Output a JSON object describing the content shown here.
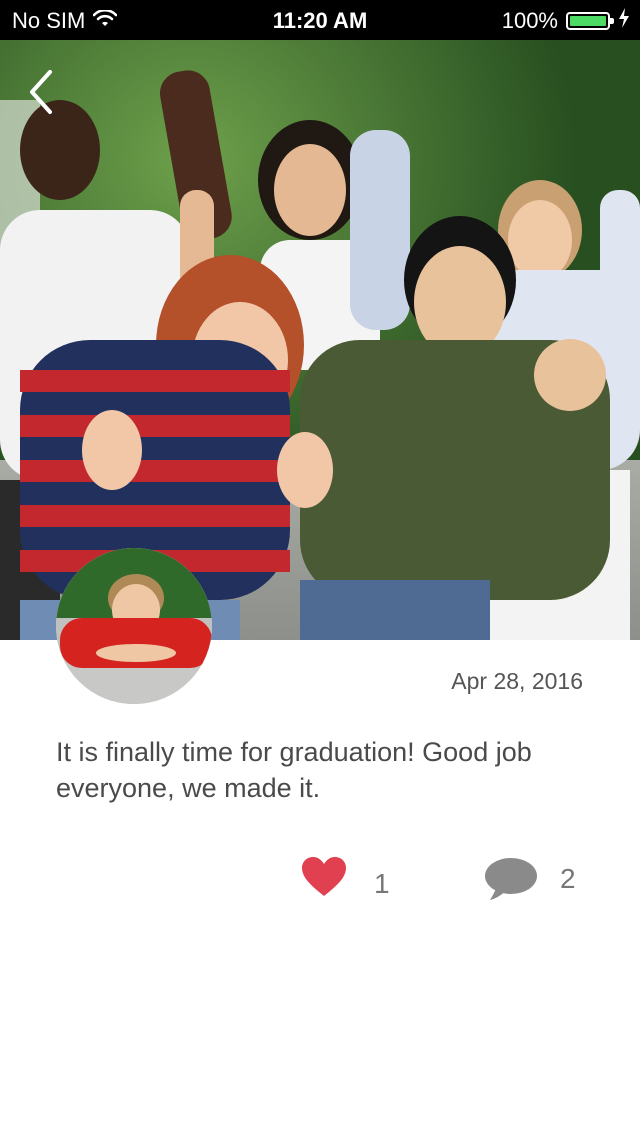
{
  "status_bar": {
    "carrier": "No SIM",
    "time": "11:20 AM",
    "battery_percent": "100%",
    "battery_color": "#4cd964",
    "icons": [
      "wifi-icon",
      "battery-icon",
      "charging-bolt-icon"
    ]
  },
  "navigation": {
    "back_icon": "chevron-left-icon"
  },
  "post": {
    "date": "Apr 28, 2016",
    "text": "It is finally time for graduation! Good job everyone, we made it.",
    "likes": {
      "icon": "heart-icon",
      "count": "1",
      "color": "#e0404f"
    },
    "comments": {
      "icon": "comment-bubble-icon",
      "count": "2",
      "color": "#8a8a8a"
    }
  }
}
